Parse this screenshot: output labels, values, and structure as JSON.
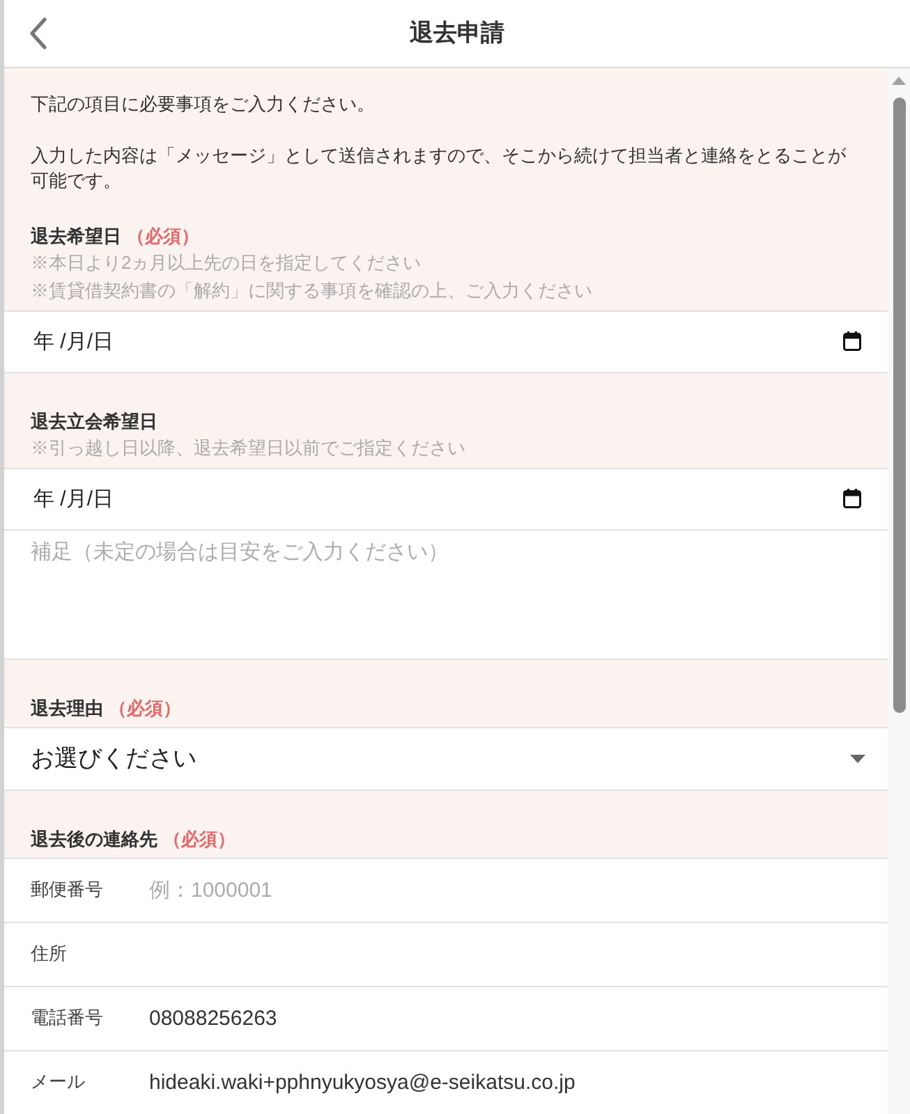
{
  "header": {
    "title": "退去申請"
  },
  "intro": [
    "下記の項目に必要事項をご入力ください。",
    "入力した内容は「メッセージ」として送信されますので、そこから続けて担当者と連絡をとることが可能です。"
  ],
  "sections": [
    {
      "kind": "date",
      "label": "退去希望日",
      "required_mark": "（必須）",
      "hints": [
        "※本日より2ヵ月以上先の日を指定してください",
        "※賃貸借契約書の「解約」に関する事項を確認の上、ご入力ください"
      ],
      "date_field": {
        "placeholder": "年 /月/日"
      }
    },
    {
      "kind": "date",
      "label": "退去立会希望日",
      "hints": [
        "※引っ越し日以降、退去希望日以前でご指定ください"
      ],
      "date_field": {
        "placeholder": "年 /月/日"
      },
      "note_field": {
        "placeholder": "補足（未定の場合は目安をご入力ください）"
      }
    },
    {
      "kind": "select",
      "label": "退去理由",
      "required_mark": "（必須）",
      "select": {
        "value": "お選びください"
      }
    },
    {
      "kind": "contact",
      "label": "退去後の連絡先",
      "required_mark": "（必須）",
      "rows": [
        {
          "label": "郵便番号",
          "placeholder": "例：1000001"
        },
        {
          "label": "住所"
        },
        {
          "label": "電話番号",
          "value": "08088256263"
        },
        {
          "label": "メール",
          "value": "hideaki.waki+pphnyukyosya@e-seikatsu.co.jp"
        }
      ]
    }
  ]
}
